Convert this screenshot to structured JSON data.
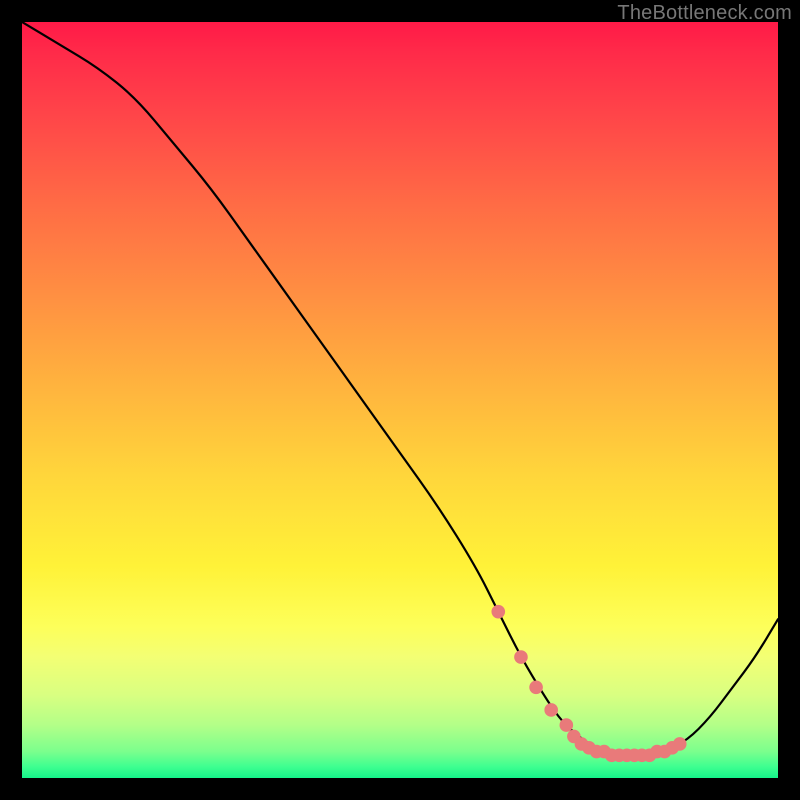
{
  "attribution": "TheBottleneck.com",
  "chart_data": {
    "type": "line",
    "title": "",
    "xlabel": "",
    "ylabel": "",
    "xlim": [
      0,
      100
    ],
    "ylim": [
      0,
      100
    ],
    "grid": false,
    "series": [
      {
        "name": "bottleneck-curve",
        "color": "#000000",
        "x": [
          0,
          5,
          10,
          15,
          20,
          25,
          30,
          35,
          40,
          45,
          50,
          55,
          60,
          63,
          66,
          69,
          71,
          73,
          75,
          77,
          79,
          81,
          83,
          85,
          88,
          91,
          94,
          97,
          100
        ],
        "values": [
          100,
          97,
          94,
          90,
          84,
          78,
          71,
          64,
          57,
          50,
          43,
          36,
          28,
          22,
          16,
          11,
          8,
          6,
          4.5,
          3.5,
          3,
          3,
          3,
          3.5,
          5,
          8,
          12,
          16,
          21
        ]
      },
      {
        "name": "highlight-dots",
        "color": "#e97a7a",
        "x": [
          63,
          66,
          68,
          70,
          72,
          73,
          74,
          75,
          76,
          77,
          78,
          79,
          80,
          81,
          82,
          83,
          84,
          85,
          86,
          87
        ],
        "values": [
          22,
          16,
          12,
          9,
          7,
          5.5,
          4.5,
          4,
          3.5,
          3.5,
          3,
          3,
          3,
          3,
          3,
          3,
          3.5,
          3.5,
          4,
          4.5
        ]
      }
    ]
  },
  "colors": {
    "background": "#000000",
    "curve": "#000000",
    "dots": "#e97a7a",
    "attribution": "#777777"
  }
}
